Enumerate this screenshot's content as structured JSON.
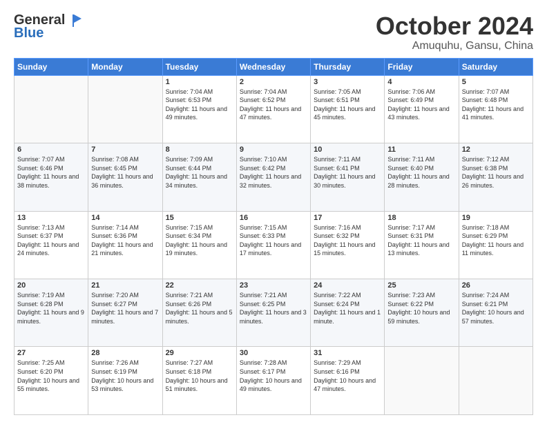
{
  "logo": {
    "general": "General",
    "blue": "Blue"
  },
  "header": {
    "month": "October 2024",
    "location": "Amuquhu, Gansu, China"
  },
  "days_of_week": [
    "Sunday",
    "Monday",
    "Tuesday",
    "Wednesday",
    "Thursday",
    "Friday",
    "Saturday"
  ],
  "weeks": [
    [
      {
        "day": "",
        "sunrise": "",
        "sunset": "",
        "daylight": "",
        "empty": true
      },
      {
        "day": "",
        "sunrise": "",
        "sunset": "",
        "daylight": "",
        "empty": true
      },
      {
        "day": "1",
        "sunrise": "Sunrise: 7:04 AM",
        "sunset": "Sunset: 6:53 PM",
        "daylight": "Daylight: 11 hours and 49 minutes."
      },
      {
        "day": "2",
        "sunrise": "Sunrise: 7:04 AM",
        "sunset": "Sunset: 6:52 PM",
        "daylight": "Daylight: 11 hours and 47 minutes."
      },
      {
        "day": "3",
        "sunrise": "Sunrise: 7:05 AM",
        "sunset": "Sunset: 6:51 PM",
        "daylight": "Daylight: 11 hours and 45 minutes."
      },
      {
        "day": "4",
        "sunrise": "Sunrise: 7:06 AM",
        "sunset": "Sunset: 6:49 PM",
        "daylight": "Daylight: 11 hours and 43 minutes."
      },
      {
        "day": "5",
        "sunrise": "Sunrise: 7:07 AM",
        "sunset": "Sunset: 6:48 PM",
        "daylight": "Daylight: 11 hours and 41 minutes."
      }
    ],
    [
      {
        "day": "6",
        "sunrise": "Sunrise: 7:07 AM",
        "sunset": "Sunset: 6:46 PM",
        "daylight": "Daylight: 11 hours and 38 minutes."
      },
      {
        "day": "7",
        "sunrise": "Sunrise: 7:08 AM",
        "sunset": "Sunset: 6:45 PM",
        "daylight": "Daylight: 11 hours and 36 minutes."
      },
      {
        "day": "8",
        "sunrise": "Sunrise: 7:09 AM",
        "sunset": "Sunset: 6:44 PM",
        "daylight": "Daylight: 11 hours and 34 minutes."
      },
      {
        "day": "9",
        "sunrise": "Sunrise: 7:10 AM",
        "sunset": "Sunset: 6:42 PM",
        "daylight": "Daylight: 11 hours and 32 minutes."
      },
      {
        "day": "10",
        "sunrise": "Sunrise: 7:11 AM",
        "sunset": "Sunset: 6:41 PM",
        "daylight": "Daylight: 11 hours and 30 minutes."
      },
      {
        "day": "11",
        "sunrise": "Sunrise: 7:11 AM",
        "sunset": "Sunset: 6:40 PM",
        "daylight": "Daylight: 11 hours and 28 minutes."
      },
      {
        "day": "12",
        "sunrise": "Sunrise: 7:12 AM",
        "sunset": "Sunset: 6:38 PM",
        "daylight": "Daylight: 11 hours and 26 minutes."
      }
    ],
    [
      {
        "day": "13",
        "sunrise": "Sunrise: 7:13 AM",
        "sunset": "Sunset: 6:37 PM",
        "daylight": "Daylight: 11 hours and 24 minutes."
      },
      {
        "day": "14",
        "sunrise": "Sunrise: 7:14 AM",
        "sunset": "Sunset: 6:36 PM",
        "daylight": "Daylight: 11 hours and 21 minutes."
      },
      {
        "day": "15",
        "sunrise": "Sunrise: 7:15 AM",
        "sunset": "Sunset: 6:34 PM",
        "daylight": "Daylight: 11 hours and 19 minutes."
      },
      {
        "day": "16",
        "sunrise": "Sunrise: 7:15 AM",
        "sunset": "Sunset: 6:33 PM",
        "daylight": "Daylight: 11 hours and 17 minutes."
      },
      {
        "day": "17",
        "sunrise": "Sunrise: 7:16 AM",
        "sunset": "Sunset: 6:32 PM",
        "daylight": "Daylight: 11 hours and 15 minutes."
      },
      {
        "day": "18",
        "sunrise": "Sunrise: 7:17 AM",
        "sunset": "Sunset: 6:31 PM",
        "daylight": "Daylight: 11 hours and 13 minutes."
      },
      {
        "day": "19",
        "sunrise": "Sunrise: 7:18 AM",
        "sunset": "Sunset: 6:29 PM",
        "daylight": "Daylight: 11 hours and 11 minutes."
      }
    ],
    [
      {
        "day": "20",
        "sunrise": "Sunrise: 7:19 AM",
        "sunset": "Sunset: 6:28 PM",
        "daylight": "Daylight: 11 hours and 9 minutes."
      },
      {
        "day": "21",
        "sunrise": "Sunrise: 7:20 AM",
        "sunset": "Sunset: 6:27 PM",
        "daylight": "Daylight: 11 hours and 7 minutes."
      },
      {
        "day": "22",
        "sunrise": "Sunrise: 7:21 AM",
        "sunset": "Sunset: 6:26 PM",
        "daylight": "Daylight: 11 hours and 5 minutes."
      },
      {
        "day": "23",
        "sunrise": "Sunrise: 7:21 AM",
        "sunset": "Sunset: 6:25 PM",
        "daylight": "Daylight: 11 hours and 3 minutes."
      },
      {
        "day": "24",
        "sunrise": "Sunrise: 7:22 AM",
        "sunset": "Sunset: 6:24 PM",
        "daylight": "Daylight: 11 hours and 1 minute."
      },
      {
        "day": "25",
        "sunrise": "Sunrise: 7:23 AM",
        "sunset": "Sunset: 6:22 PM",
        "daylight": "Daylight: 10 hours and 59 minutes."
      },
      {
        "day": "26",
        "sunrise": "Sunrise: 7:24 AM",
        "sunset": "Sunset: 6:21 PM",
        "daylight": "Daylight: 10 hours and 57 minutes."
      }
    ],
    [
      {
        "day": "27",
        "sunrise": "Sunrise: 7:25 AM",
        "sunset": "Sunset: 6:20 PM",
        "daylight": "Daylight: 10 hours and 55 minutes."
      },
      {
        "day": "28",
        "sunrise": "Sunrise: 7:26 AM",
        "sunset": "Sunset: 6:19 PM",
        "daylight": "Daylight: 10 hours and 53 minutes."
      },
      {
        "day": "29",
        "sunrise": "Sunrise: 7:27 AM",
        "sunset": "Sunset: 6:18 PM",
        "daylight": "Daylight: 10 hours and 51 minutes."
      },
      {
        "day": "30",
        "sunrise": "Sunrise: 7:28 AM",
        "sunset": "Sunset: 6:17 PM",
        "daylight": "Daylight: 10 hours and 49 minutes."
      },
      {
        "day": "31",
        "sunrise": "Sunrise: 7:29 AM",
        "sunset": "Sunset: 6:16 PM",
        "daylight": "Daylight: 10 hours and 47 minutes."
      },
      {
        "day": "",
        "sunrise": "",
        "sunset": "",
        "daylight": "",
        "empty": true
      },
      {
        "day": "",
        "sunrise": "",
        "sunset": "",
        "daylight": "",
        "empty": true
      }
    ]
  ]
}
